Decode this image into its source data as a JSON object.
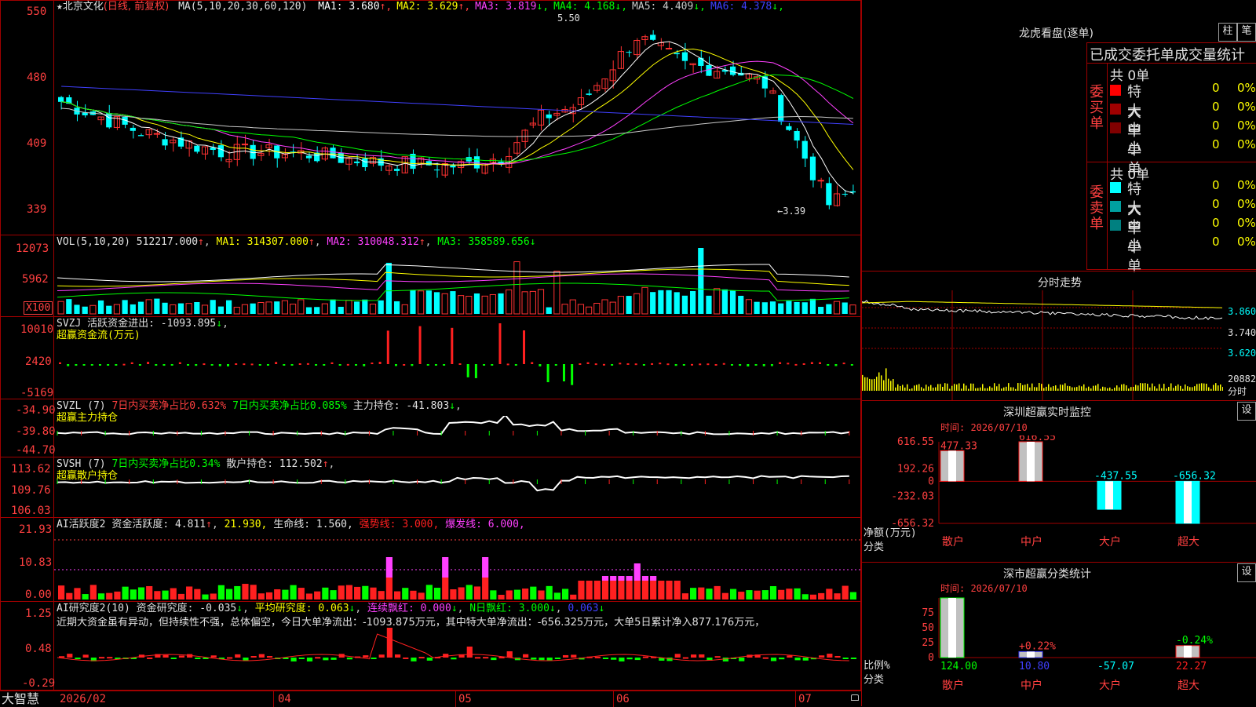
{
  "header": {
    "star": "★",
    "stock": "北京文化",
    "period": "(日线, 前复权)",
    "ma_label": "MA(5,10,20,30,60,120)",
    "ma": [
      {
        "label": "MA1:",
        "value": "3.680",
        "arrow": "↑",
        "color": "#ffffff"
      },
      {
        "label": "MA2:",
        "value": "3.629",
        "arrow": "↑",
        "color": "#ffff00"
      },
      {
        "label": "MA3:",
        "value": "3.819",
        "arrow": "↓",
        "color": "#ff40ff"
      },
      {
        "label": "MA4:",
        "value": "4.168",
        "arrow": "↓",
        "color": "#00ff00"
      },
      {
        "label": "MA5:",
        "value": "4.409",
        "arrow": "↓",
        "color": "#c8c8c8"
      },
      {
        "label": "MA6:",
        "value": "4.378",
        "arrow": "↓",
        "color": "#4040ff"
      }
    ],
    "high_mark": "5.50",
    "low_mark": "←3.39"
  },
  "price_axis": [
    "550",
    "480",
    "409",
    "339"
  ],
  "vol_header": {
    "title": "VOL(5,10,20)",
    "value": "512217.000",
    "ma1": "MA1: 314307.000",
    "ma2": "MA2: 310048.312",
    "ma3": "MA3: 358589.656"
  },
  "vol_axis": [
    "12073",
    "5962",
    "X100"
  ],
  "svzj": {
    "title": "SVZJ  活跃资金进出:",
    "value": "-1093.895",
    "sub": "超赢资金流(万元)",
    "axis": [
      "10010",
      "2420",
      "-5169"
    ]
  },
  "svzl": {
    "title": "SVZL (7)",
    "t1": "7日内买卖净占比0.632%",
    "t2": "7日内买卖净占比0.085%",
    "t3": "主力持仓: -41.803",
    "sub": "超赢主力持仓",
    "axis": [
      "-34.90",
      "-39.80",
      "-44.70"
    ]
  },
  "svsh": {
    "title": "SVSH (7)",
    "t1": "7日内买卖净占比0.34%",
    "t2": "散户持仓: 112.502",
    "sub": "超赢散户持仓",
    "axis": [
      "113.62",
      "109.76",
      "106.03"
    ]
  },
  "ai_active": {
    "title": "AI活跃度2",
    "t1": "资金活跃度: 4.811",
    "t2": "21.930,",
    "t3": "生命线: 1.560,",
    "t4": "强势线: 3.000,",
    "t5": "爆发线: 6.000,",
    "axis": [
      "21.93",
      "10.83",
      "0.00"
    ]
  },
  "ai_research": {
    "title": "AI研究度2(10)",
    "t1": "资金研究度: -0.035",
    "t2": "平均研究度: 0.063",
    "t3": "连续飘红: 0.000",
    "t4": "N日飘红: 3.000",
    "t5": "0.063",
    "comment": "近期大资金虽有异动，但持续性不强，总体偏空，今日大单净流出：-1093.875万元，其中特大单净流出：-656.325万元，大单5日累计净入877.176万元，",
    "axis": [
      "1.25",
      "0.48",
      "-0.29"
    ]
  },
  "date_axis": [
    "2026/02",
    "04",
    "05",
    "06",
    "07"
  ],
  "footer_brand": "大智慧",
  "right": {
    "dragon_title": "龙虎看盘(逐单)",
    "btn_zhu": "柱",
    "btn_bi": "笔",
    "order_header": "已成交委托单成交量统计",
    "buy_label": "委买单",
    "sell_label": "委卖单",
    "buy_total": "共 0单",
    "sell_total": "共 0单",
    "buy_rows": [
      {
        "name": "特大",
        "value": "0",
        "pct": "0%",
        "color": "#ff0000"
      },
      {
        "name": "大单",
        "value": "0",
        "pct": "0%",
        "color": "#a00000"
      },
      {
        "name": "中单",
        "value": "0",
        "pct": "0%",
        "color": "#800000"
      },
      {
        "name": "小单",
        "value": "0",
        "pct": "0%",
        "color": "#000000"
      }
    ],
    "sell_rows": [
      {
        "name": "特大",
        "value": "0",
        "pct": "0%",
        "color": "#00ffff"
      },
      {
        "name": "大单",
        "value": "0",
        "pct": "0%",
        "color": "#00a0a0"
      },
      {
        "name": "中单",
        "value": "0",
        "pct": "0%",
        "color": "#008080"
      },
      {
        "name": "小单",
        "value": "0",
        "pct": "0%",
        "color": "#000000"
      }
    ],
    "intraday_title": "分时走势",
    "intraday_axis": [
      "3.860",
      "3.740",
      "3.620"
    ],
    "intraday_vol": "20882",
    "intraday_vol_lbl": "分时",
    "monitor_title": "深圳超赢实时监控",
    "monitor_btn": "设",
    "monitor_time": "时间: 2026/07/10",
    "monitor_axis": [
      "616.55",
      "192.26",
      "0",
      "-232.03",
      "-656.32"
    ],
    "monitor_ylabel": "净额(万元)",
    "monitor_xlabel": "分类",
    "classify_title": "深市超赢分类统计",
    "classify_btn": "设",
    "classify_time": "时间: 2026/07/10",
    "classify_axis": [
      "75",
      "50",
      "25",
      "0"
    ],
    "classify_ylabel": "比例%",
    "classify_xlabel": "分类"
  },
  "chart_data": [
    {
      "type": "bar",
      "title": "深圳超赢实时监控",
      "ylabel": "净额(万元)",
      "xlabel": "分类",
      "categories": [
        "散户",
        "中户",
        "大户",
        "超大"
      ],
      "values": [
        477.33,
        616.55,
        -437.55,
        -656.32
      ],
      "labels": [
        "477.33",
        "616.55",
        "-437.55",
        "-656.32"
      ],
      "ylim": [
        -656.32,
        616.55
      ]
    },
    {
      "type": "bar",
      "title": "深市超赢分类统计",
      "ylabel": "比例%",
      "xlabel": "分类",
      "categories": [
        "散户",
        "中户",
        "大户",
        "超大"
      ],
      "values": [
        124.0,
        10.8,
        -57.07,
        22.27
      ],
      "pct_labels": [
        "",
        "+0.22%",
        "",
        "-0.24%"
      ],
      "bar_heights": [
        100,
        10,
        0,
        20
      ],
      "ylim": [
        0,
        100
      ]
    },
    {
      "type": "line",
      "title": "北京文化 (日线, 前复权)",
      "x": [
        "2026/02",
        "04",
        "05",
        "06",
        "07"
      ],
      "ylim": [
        3.39,
        5.5
      ],
      "series": [
        {
          "name": "MA1",
          "values": [
            4.6,
            4.12,
            4.05,
            4.62,
            5.05,
            4.45,
            3.68
          ]
        },
        {
          "name": "MA2",
          "values": [
            4.55,
            4.18,
            4.06,
            4.5,
            4.95,
            4.55,
            3.63
          ]
        },
        {
          "name": "MA3",
          "values": [
            4.5,
            4.22,
            4.1,
            4.35,
            4.85,
            4.7,
            3.82
          ]
        },
        {
          "name": "MA6",
          "values": [
            4.83,
            4.74,
            4.6,
            4.6,
            4.52,
            4.5,
            4.38
          ]
        }
      ]
    }
  ]
}
